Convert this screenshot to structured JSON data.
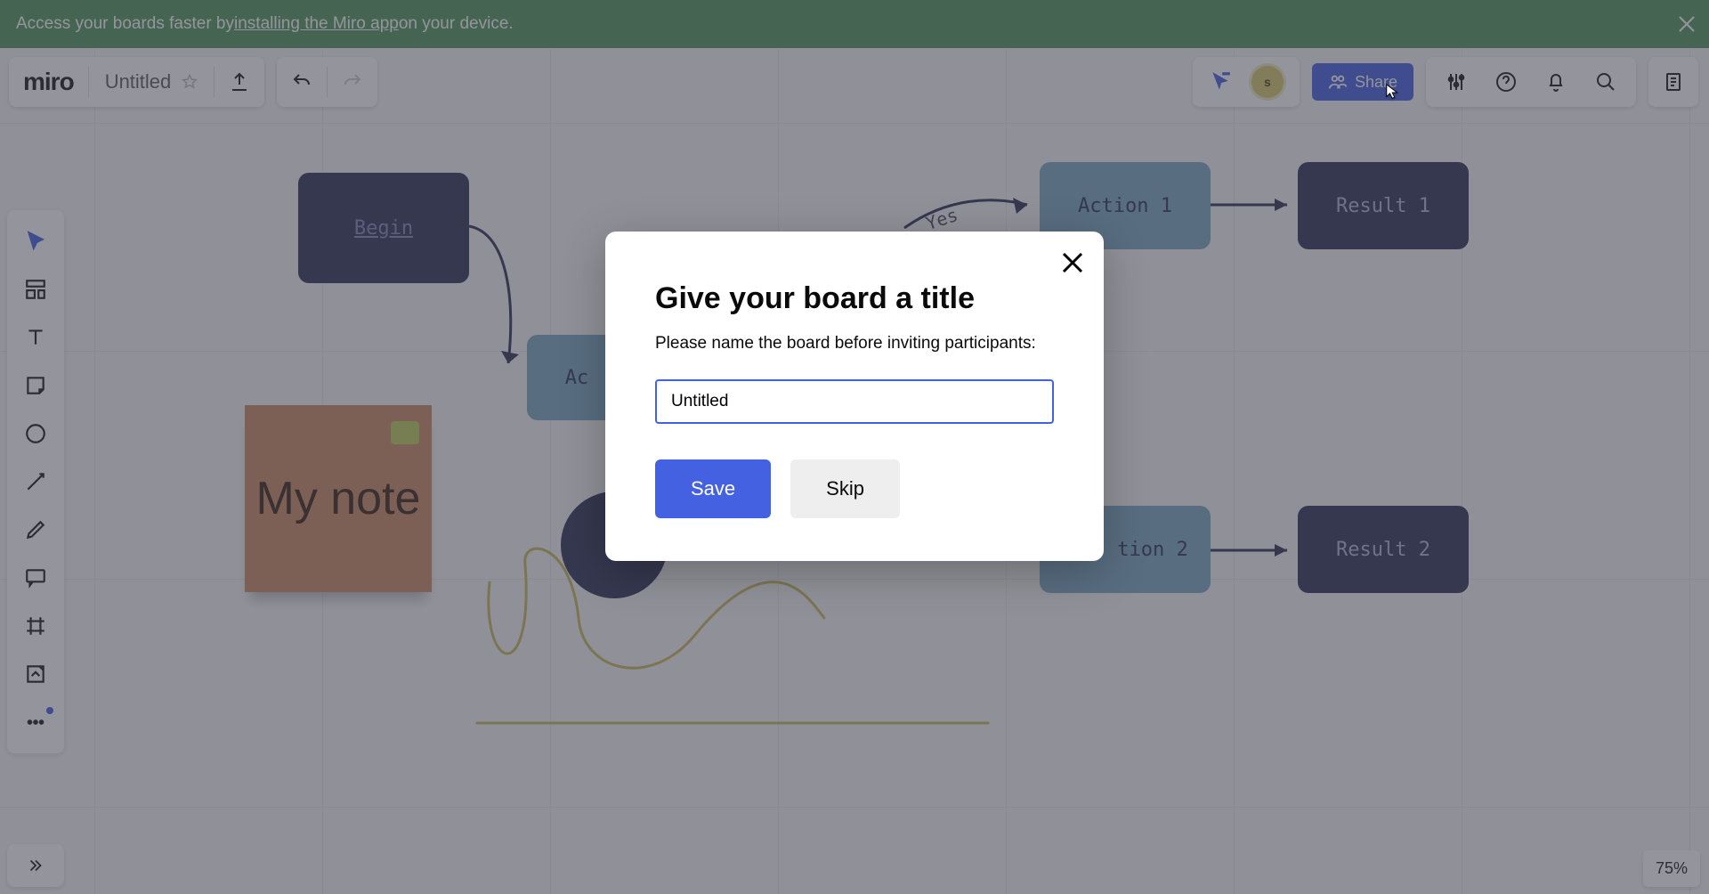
{
  "banner": {
    "prefix": "Access your boards faster by ",
    "link_text": "installing the Miro app",
    "suffix": " on your device."
  },
  "header": {
    "logo": "miro",
    "board_title": "Untitled",
    "share_label": "Share",
    "avatar_initial": "s"
  },
  "zoom": {
    "label": "75%"
  },
  "canvas": {
    "begin": "Begin",
    "action_partial": "Ac",
    "action1": "Action 1",
    "action2": "tion 2",
    "result1": "Result 1",
    "result2": "Result 2",
    "yes": "Yes",
    "sticky": "My note"
  },
  "modal": {
    "title": "Give your board a title",
    "body": "Please name the board before inviting participants:",
    "input_value": "Untitled",
    "save": "Save",
    "skip": "Skip"
  },
  "toolbar": {
    "items": [
      "select-tool",
      "template-tool",
      "text-tool",
      "sticky-tool",
      "shape-tool",
      "connector-tool",
      "pen-tool",
      "comment-tool",
      "frame-tool",
      "upload-tool",
      "more-tool"
    ]
  }
}
